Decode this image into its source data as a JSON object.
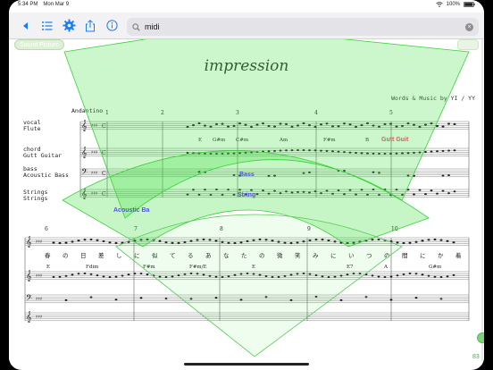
{
  "status_bar": {
    "time": "5:34 PM",
    "date": "Mon Mar 9",
    "battery": "100%"
  },
  "toolbar": {
    "search_value": "midi",
    "icons": [
      "back-icon",
      "list-icon",
      "gear-icon",
      "share-icon",
      "info-icon",
      "search-icon",
      "clear-icon"
    ]
  },
  "score": {
    "sound_picture_label": "Sound Picture",
    "title": "impression",
    "credits": "Words & Music by YI / YY",
    "tempo": "Andantino",
    "system1": {
      "measures": [
        "1",
        "2",
        "3",
        "4",
        "5"
      ],
      "instruments": [
        {
          "part": "vocal",
          "name": "Flute"
        },
        {
          "part": "chord",
          "name": "Gutt Guitar"
        },
        {
          "part": "bass",
          "name": "Acoustic Bass"
        },
        {
          "part": "Strings",
          "name": "Strings"
        }
      ],
      "chords": [
        "E",
        "G#m",
        "C#m",
        "Am",
        "F#m",
        "B"
      ]
    },
    "system2": {
      "measures": [
        "6",
        "7",
        "8",
        "9",
        "10"
      ],
      "lyrics": [
        "春",
        "の",
        "日",
        "差",
        "し",
        "に",
        "似",
        "て",
        "る",
        "あ",
        "な",
        "た",
        "の",
        "微",
        "笑",
        "み",
        "に",
        "い",
        "つ",
        "の",
        "間",
        "に",
        "か",
        "着"
      ],
      "chords": [
        "E",
        "Fdim",
        "F#m",
        "F#m/E",
        "E",
        "E7",
        "A",
        "G#m"
      ]
    }
  },
  "overlay_labels": {
    "gutt": "Gutt Guit",
    "bass": "Bass",
    "string": "String",
    "acoustic": "Acoustic Ba"
  },
  "colors": {
    "accent": "#1a7cf0",
    "overlay_fill": "#34e034",
    "label_red": "#e05a5a",
    "label_blue": "#5555dd"
  },
  "slider": {
    "value": "83"
  }
}
